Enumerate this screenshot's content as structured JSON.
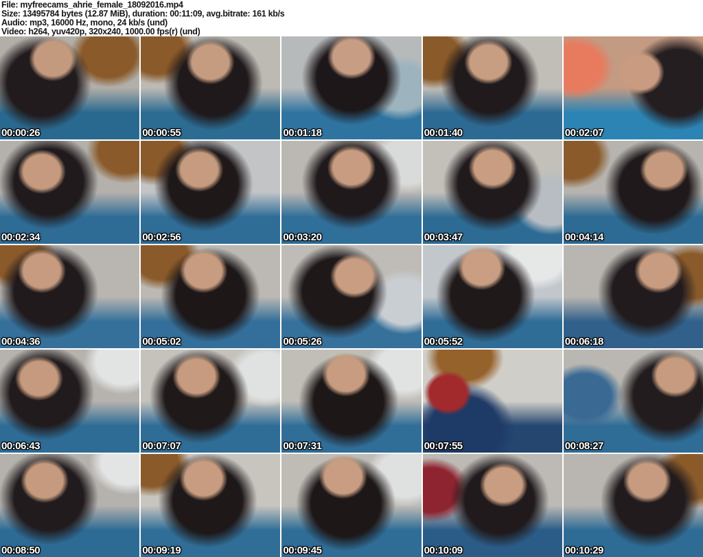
{
  "header": {
    "file": "File: myfreecams_ahrie_female_18092016.mp4",
    "size": "Size: 13495784 bytes (12.87 MiB), duration: 00:11:09, avg.bitrate: 161 kb/s",
    "audio": "Audio: mp3, 16000 Hz, mono, 24 kb/s (und)",
    "video": "Video: h264, yuv420p, 320x240, 1000.00 fps(r) (und)"
  },
  "colors": {
    "header_background": "#ffffff",
    "header_text": "#151515",
    "timestamp_text": "#ffffff",
    "timestamp_outline": "#000000",
    "grid_gap": "#ffffff"
  },
  "grid": {
    "columns": 5,
    "rows": 5,
    "thumbnails": [
      {
        "time": "00:00:26",
        "wall": "#b2aea8",
        "shirt": "#2a698f",
        "hair": "#211b1d",
        "hair_at": "30% 45%",
        "skin": "#c49a7f",
        "face_at": "38% 22%",
        "accent": "#8a5a2a",
        "accent_at": "78% 18%"
      },
      {
        "time": "00:00:55",
        "wall": "#bdbab4",
        "shirt": "#2c6b92",
        "hair": "#1f191b",
        "hair_at": "52% 45%",
        "skin": "#c69c80",
        "face_at": "50% 25%",
        "accent": "#8a5a2a",
        "accent_at": "12% 15%"
      },
      {
        "time": "00:01:18",
        "wall": "#b7babb",
        "shirt": "#2f74a1",
        "hair": "#1d1719",
        "hair_at": "50% 40%",
        "skin": "#c79e84",
        "face_at": "50% 20%",
        "accent": "#9db3bd",
        "accent_at": "85% 50%"
      },
      {
        "time": "00:01:40",
        "wall": "#c1beb8",
        "shirt": "#2d6a93",
        "hair": "#201a1c",
        "hair_at": "48% 42%",
        "skin": "#c89e82",
        "face_at": "47% 25%",
        "accent": "#8a5a2a",
        "accent_at": "8% 20%"
      },
      {
        "time": "00:02:07",
        "wall": "#c39a82",
        "shirt": "#2c84b4",
        "hair": "#241e20",
        "hair_at": "82% 45%",
        "skin": "#c99b80",
        "face_at": "55% 35%",
        "accent": "#e87a5e",
        "accent_at": "8% 30%"
      },
      {
        "time": "00:02:34",
        "wall": "#b4b1ac",
        "shirt": "#2e6c96",
        "hair": "#201a1c",
        "hair_at": "35% 40%",
        "skin": "#c59a7e",
        "face_at": "30% 30%",
        "accent": "#8a5a2a",
        "accent_at": "90% 10%"
      },
      {
        "time": "00:02:56",
        "wall": "#c2c4c6",
        "shirt": "#2f6d97",
        "hair": "#1e1819",
        "hair_at": "45% 42%",
        "skin": "#c69b7f",
        "face_at": "42% 28%",
        "accent": "#8a5a2a",
        "accent_at": "10% 12%"
      },
      {
        "time": "00:03:20",
        "wall": "#bbb8b3",
        "shirt": "#306f99",
        "hair": "#1f191b",
        "hair_at": "50% 40%",
        "skin": "#c79c80",
        "face_at": "50% 26%",
        "accent": "#d9dbdb",
        "accent_at": "90% 20%"
      },
      {
        "time": "00:03:47",
        "wall": "#c3c0ba",
        "shirt": "#2e6b94",
        "hair": "#201a1c",
        "hair_at": "50% 42%",
        "skin": "#c89d81",
        "face_at": "50% 26%",
        "accent": "#b7bdc2",
        "accent_at": "92% 60%"
      },
      {
        "time": "00:04:14",
        "wall": "#b7b4af",
        "shirt": "#2d6b94",
        "hair": "#1f191b",
        "hair_at": "65% 45%",
        "skin": "#c59a7e",
        "face_at": "72% 28%",
        "accent": "#8a5a2a",
        "accent_at": "6% 15%"
      },
      {
        "time": "00:04:36",
        "wall": "#b9b6b1",
        "shirt": "#35709b",
        "hair": "#201a1c",
        "hair_at": "35% 45%",
        "skin": "#c69b7f",
        "face_at": "30% 25%",
        "accent": "#8a5a2a",
        "accent_at": "12% 12%"
      },
      {
        "time": "00:05:02",
        "wall": "#bcb9b4",
        "shirt": "#336f9a",
        "hair": "#1d1718",
        "hair_at": "50% 48%",
        "skin": "#c79c80",
        "face_at": "45% 25%",
        "accent": "#8a5a2a",
        "accent_at": "15% 12%"
      },
      {
        "time": "00:05:26",
        "wall": "#bfbcb7",
        "shirt": "#36719c",
        "hair": "#1e1819",
        "hair_at": "40% 45%",
        "skin": "#c89d81",
        "face_at": "52% 30%",
        "accent": "#c9ced2",
        "accent_at": "88% 55%"
      },
      {
        "time": "00:05:52",
        "wall": "#c2c7cc",
        "shirt": "#2f6c96",
        "hair": "#1f191a",
        "hair_at": "45% 48%",
        "skin": "#c99e82",
        "face_at": "42% 22%",
        "accent": "#e6e8e8",
        "accent_at": "82% 12%"
      },
      {
        "time": "00:06:18",
        "wall": "#b9b6b1",
        "shirt": "#31608a",
        "hair": "#211b1d",
        "hair_at": "60% 45%",
        "skin": "#c79c80",
        "face_at": "68% 25%",
        "accent": "#8a5a2a",
        "accent_at": "92% 30%"
      },
      {
        "time": "00:06:43",
        "wall": "#b6b3ae",
        "shirt": "#2e6c96",
        "hair": "#211b1d",
        "hair_at": "32% 42%",
        "skin": "#c59a7e",
        "face_at": "28% 28%",
        "accent": "#e2e4e4",
        "accent_at": "88% 12%"
      },
      {
        "time": "00:07:07",
        "wall": "#c5c2bc",
        "shirt": "#2f6d97",
        "hair": "#1f1919",
        "hair_at": "42% 45%",
        "skin": "#c69b7f",
        "face_at": "40% 26%",
        "accent": "#e0e2e2",
        "accent_at": "90% 25%"
      },
      {
        "time": "00:07:31",
        "wall": "#c1beb8",
        "shirt": "#306e98",
        "hair": "#1d1717",
        "hair_at": "48% 50%",
        "skin": "#c79c80",
        "face_at": "46% 24%",
        "accent": "#e1e3e3",
        "accent_at": "88% 18%"
      },
      {
        "time": "00:07:55",
        "wall": "#d0cec8",
        "shirt": "#24466f",
        "hair": "#1e3a66",
        "hair_at": "30% 78%",
        "skin": "#a32a2c",
        "face_at": "18% 42%",
        "accent": "#96622c",
        "accent_at": "30% 8%"
      },
      {
        "time": "00:08:27",
        "wall": "#bab7b2",
        "shirt": "#2f6d97",
        "hair": "#221c1e",
        "hair_at": "75% 45%",
        "skin": "#c69b7f",
        "face_at": "80% 25%",
        "accent": "#3a6a94",
        "accent_at": "15% 45%"
      },
      {
        "time": "00:08:50",
        "wall": "#b5b2ad",
        "shirt": "#2d6b95",
        "hair": "#211b1d",
        "hair_at": "35% 42%",
        "skin": "#c59a7e",
        "face_at": "32% 26%",
        "accent": "#e3e5e5",
        "accent_at": "92% 8%"
      },
      {
        "time": "00:09:19",
        "wall": "#c8c5bf",
        "shirt": "#306e98",
        "hair": "#1e1819",
        "hair_at": "48% 45%",
        "skin": "#c79c80",
        "face_at": "45% 24%",
        "accent": "#8a5a2a",
        "accent_at": "8% 10%"
      },
      {
        "time": "00:09:45",
        "wall": "#bfbcb6",
        "shirt": "#2f6d97",
        "hair": "#1d1718",
        "hair_at": "46% 48%",
        "skin": "#c89d81",
        "face_at": "44% 22%",
        "accent": "#dfe1e1",
        "accent_at": "88% 20%"
      },
      {
        "time": "00:10:09",
        "wall": "#bdbab5",
        "shirt": "#2b5c88",
        "hair": "#201a1c",
        "hair_at": "55% 45%",
        "skin": "#c89d81",
        "face_at": "58% 30%",
        "accent": "#8e2430",
        "accent_at": "6% 35%"
      },
      {
        "time": "00:10:29",
        "wall": "#b9b6b1",
        "shirt": "#2e6c96",
        "hair": "#211b1d",
        "hair_at": "62% 45%",
        "skin": "#c69b7f",
        "face_at": "60% 26%",
        "accent": "#8a5a2a",
        "accent_at": "92% 22%"
      }
    ]
  }
}
